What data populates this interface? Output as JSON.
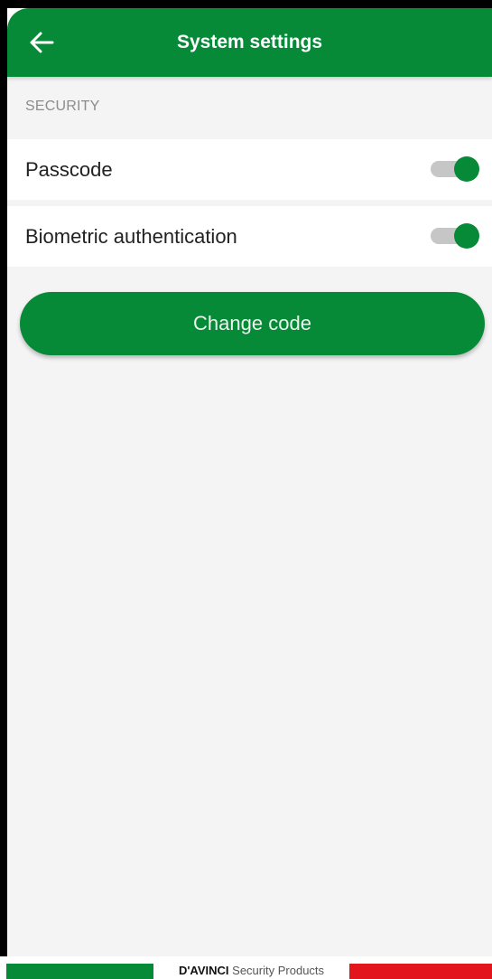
{
  "app_bar": {
    "title": "System settings",
    "back_icon": "arrow-left-icon",
    "background_color": "#068a37"
  },
  "security_section": {
    "header": "SECURITY",
    "settings": [
      {
        "label": "Passcode",
        "enabled": true
      },
      {
        "label": "Biometric authentication",
        "enabled": true
      }
    ]
  },
  "actions": {
    "change_code_label": "Change code"
  },
  "footer": {
    "brand_name": "D'AVINCI",
    "brand_tagline": "Security Products",
    "flag_colors": [
      "#068a37",
      "#ffffff",
      "#e3151c"
    ]
  },
  "colors": {
    "accent": "#068a37",
    "screen_background": "#f4f4f4",
    "toggle_track": "#c6c6c6"
  }
}
